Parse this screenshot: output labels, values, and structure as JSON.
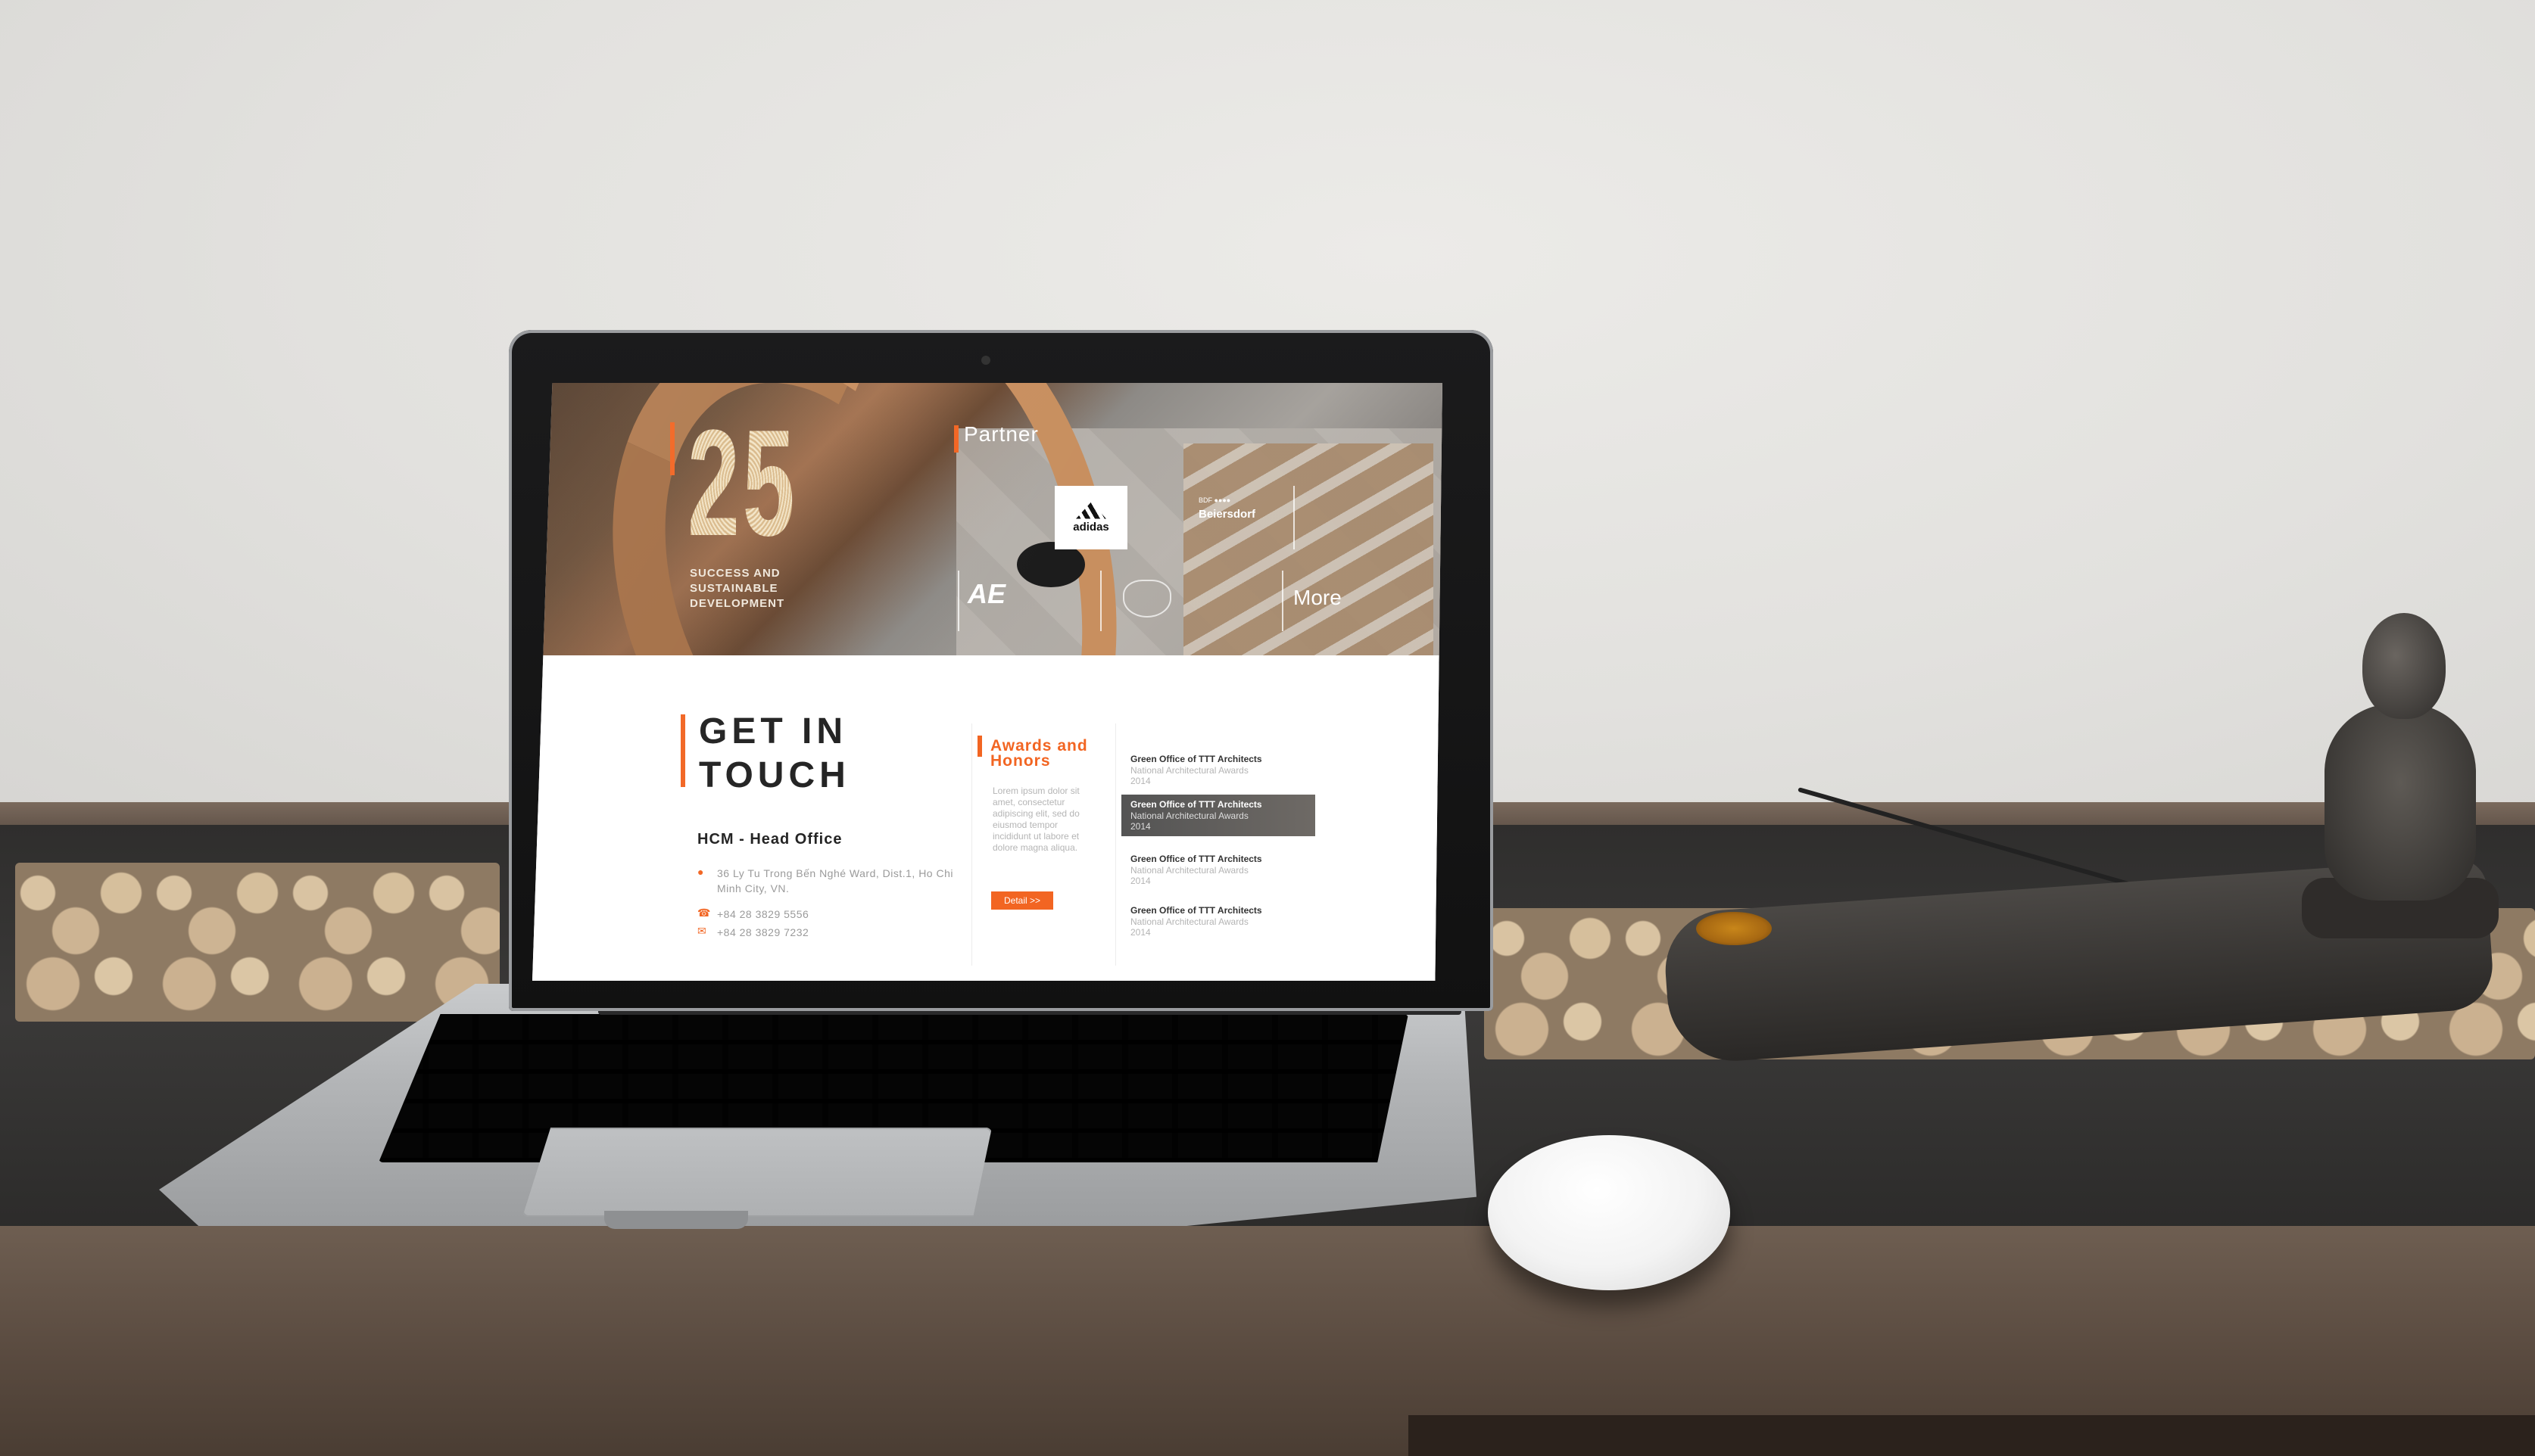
{
  "hero": {
    "big_number": "25",
    "tagline": "SUCCESS AND SUSTAINABLE DEVELOPMENT",
    "partner_title": "Partner",
    "partners": {
      "adidas": "adidas",
      "beiersdorf": "Beiersdorf",
      "beiersdorf_mark": "BDF ●●●●",
      "ae": "AE"
    },
    "more_label": "More"
  },
  "contact": {
    "title": "GET IN TOUCH",
    "office": "HCM - Head Office",
    "address": "36 Ly Tu Trong Bến Nghé Ward, Dist.1, Ho Chi Minh City, VN.",
    "phone": "+84 28 3829 5556",
    "fax": "+84 28 3829 7232"
  },
  "awards": {
    "title": "Awards and Honors",
    "description": "Lorem ipsum dolor sit amet, consectetur adipiscing elit, sed do eiusmod tempor incididunt ut labore et dolore magna aliqua.",
    "detail_label": "Detail >>",
    "items": [
      {
        "name": "Green Office of TTT Architects",
        "sub": "National Architectural Awards",
        "year": "2014"
      },
      {
        "name": "Green Office of TTT Architects",
        "sub": "National Architectural Awards",
        "year": "2014"
      },
      {
        "name": "Green Office of TTT Architects",
        "sub": "National Architectural Awards",
        "year": "2014"
      },
      {
        "name": "Green Office of TTT Architects",
        "sub": "National Architectural Awards",
        "year": "2014"
      }
    ]
  },
  "colors": {
    "accent": "#f26522",
    "text_dark": "#222222",
    "text_muted": "#9a9a9a"
  }
}
